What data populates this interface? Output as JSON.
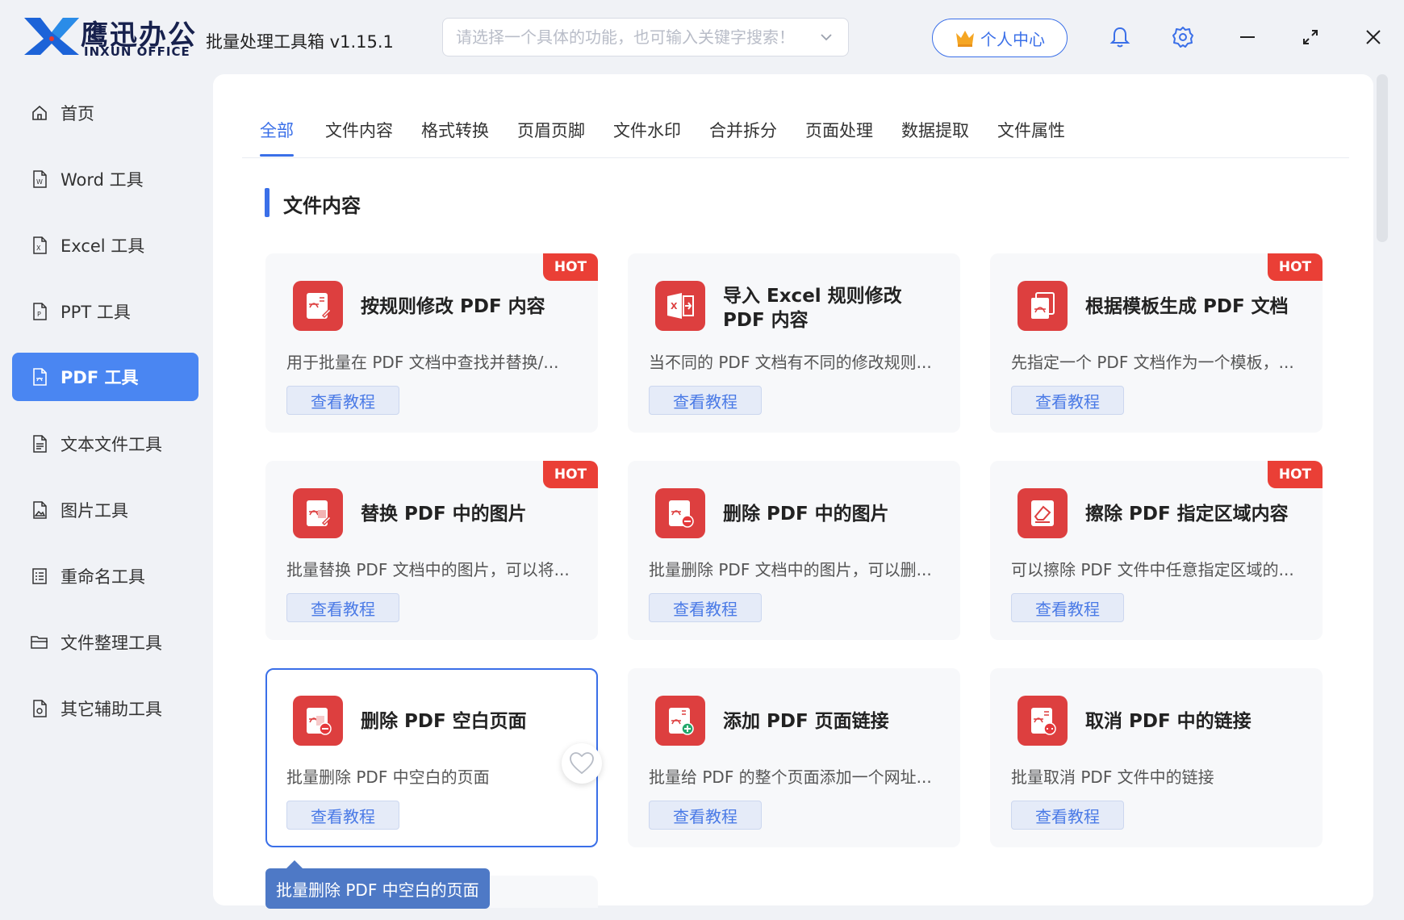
{
  "app": {
    "brand_cn": "鹰迅办公",
    "brand_en": "INXUN OFFICE",
    "title": "批量处理工具箱 v1.15.1",
    "search_placeholder": "请选择一个具体的功能，也可输入关键字搜索！",
    "user_center": "个人中心",
    "accent_color": "#3a6fe8",
    "icons": [
      "bell-icon",
      "gear-icon",
      "minimize-icon",
      "maximize-icon",
      "close-icon"
    ]
  },
  "sidebar": {
    "items": [
      {
        "label": "首页",
        "icon": "home-icon"
      },
      {
        "label": "Word 工具",
        "icon": "word-file-icon"
      },
      {
        "label": "Excel 工具",
        "icon": "excel-file-icon"
      },
      {
        "label": "PPT 工具",
        "icon": "ppt-file-icon"
      },
      {
        "label": "PDF 工具",
        "icon": "pdf-file-icon",
        "active": true
      },
      {
        "label": "文本文件工具",
        "icon": "text-file-icon"
      },
      {
        "label": "图片工具",
        "icon": "image-file-icon"
      },
      {
        "label": "重命名工具",
        "icon": "rename-icon"
      },
      {
        "label": "文件整理工具",
        "icon": "folder-icon"
      },
      {
        "label": "其它辅助工具",
        "icon": "tools-icon"
      }
    ]
  },
  "tabs": [
    "全部",
    "文件内容",
    "格式转换",
    "页眉页脚",
    "文件水印",
    "合并拆分",
    "页面处理",
    "数据提取",
    "文件属性"
  ],
  "section": {
    "title": "文件内容"
  },
  "hot_label": "HOT",
  "tutorial_label": "查看教程",
  "cards": [
    {
      "title": "按规则修改 PDF 内容",
      "desc": "用于批量在 PDF 文档中查找并替换/...",
      "hot": true
    },
    {
      "title": "导入 Excel 规则修改 PDF 内容",
      "desc": "当不同的 PDF 文档有不同的修改规则...",
      "hot": false
    },
    {
      "title": "根据模板生成 PDF 文档",
      "desc": "先指定一个 PDF 文档作为一个模板，...",
      "hot": true
    },
    {
      "title": "替换 PDF 中的图片",
      "desc": "批量替换 PDF 文档中的图片，可以将...",
      "hot": true
    },
    {
      "title": "删除 PDF 中的图片",
      "desc": "批量删除 PDF 文档中的图片，可以删...",
      "hot": false
    },
    {
      "title": "擦除 PDF 指定区域内容",
      "desc": "可以擦除 PDF 文件中任意指定区域的...",
      "hot": true
    },
    {
      "title": "删除 PDF 空白页面",
      "desc": "批量删除 PDF 中空白的页面",
      "hot": false,
      "selected": true
    },
    {
      "title": "添加 PDF 页面链接",
      "desc": "批量给 PDF 的整个页面添加一个网址...",
      "hot": false
    },
    {
      "title": "取消 PDF 中的链接",
      "desc": "批量取消 PDF 文件中的链接",
      "hot": false
    }
  ],
  "tooltip": "批量删除 PDF 中空白的页面"
}
